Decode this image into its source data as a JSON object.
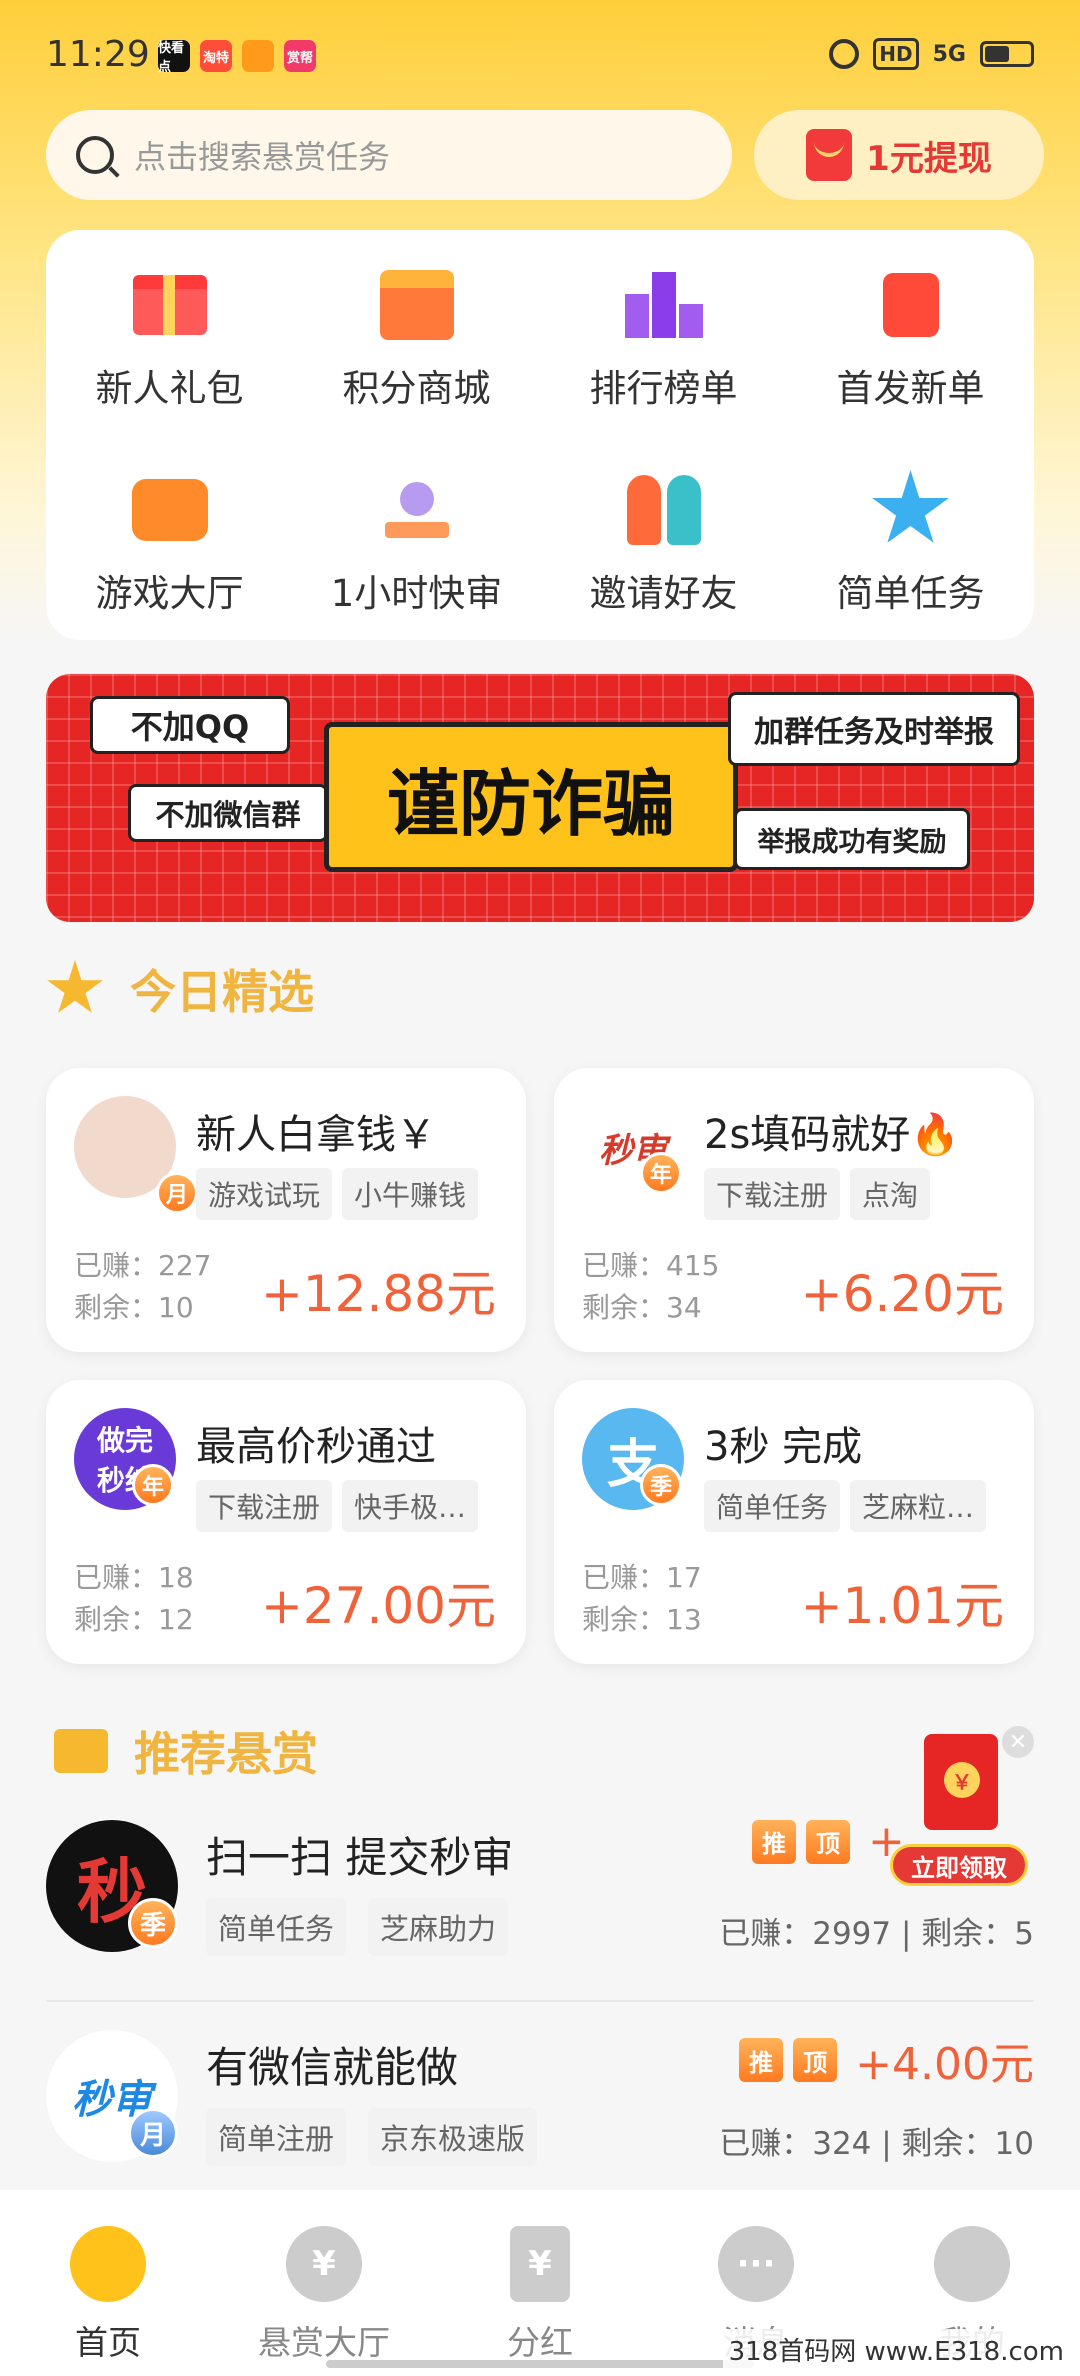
{
  "status": {
    "time": "11:29",
    "apps": [
      "快看点",
      "淘特",
      "",
      "赏帮"
    ],
    "hd": "HD",
    "network": "5G"
  },
  "search": {
    "placeholder": "点击搜索悬赏任务"
  },
  "withdraw": {
    "label": "1元提现"
  },
  "grid": [
    {
      "label": "新人礼包",
      "icon": "gift-icon"
    },
    {
      "label": "积分商城",
      "icon": "shop-icon"
    },
    {
      "label": "排行榜单",
      "icon": "podium-icon"
    },
    {
      "label": "首发新单",
      "icon": "red-packet-icon"
    },
    {
      "label": "游戏大厅",
      "icon": "gamepad-icon"
    },
    {
      "label": "1小时快审",
      "icon": "stamp-icon"
    },
    {
      "label": "邀请好友",
      "icon": "friends-icon"
    },
    {
      "label": "简单任务",
      "icon": "star-face-icon"
    }
  ],
  "banner": {
    "main": "谨防诈骗",
    "b1": "不加QQ",
    "b2": "不加微信群",
    "b3": "加群任务及时举报",
    "b4": "举报成功有奖励"
  },
  "today": {
    "title": "今日精选",
    "cards": [
      {
        "title": "新人白拿钱￥",
        "badge": "月",
        "avatar_text": "",
        "tags": [
          "游戏试玩",
          "小牛赚钱"
        ],
        "earned": "已赚：227",
        "left": "剩余：10",
        "price": "+12.88元"
      },
      {
        "title": "2s填码就好🔥",
        "badge": "年",
        "avatar_text": "秒审",
        "tags": [
          "下载注册",
          "点淘"
        ],
        "earned": "已赚：415",
        "left": "剩余：34",
        "price": "+6.20元"
      },
      {
        "title": "最高价秒通过",
        "badge": "年",
        "avatar_text": "做完秒结",
        "tags": [
          "下载注册",
          "快手极…"
        ],
        "earned": "已赚：18",
        "left": "剩余：12",
        "price": "+27.00元"
      },
      {
        "title": "3秒  完成",
        "badge": "季",
        "avatar_text": "支",
        "tags": [
          "简单任务",
          "芝麻粒…"
        ],
        "earned": "已赚：17",
        "left": "剩余：13",
        "price": "+1.01元"
      }
    ]
  },
  "recommend": {
    "title": "推荐悬赏",
    "rows": [
      {
        "title": "扫一扫 提交秒审",
        "avatar_text": "秒",
        "badge": "季",
        "tags": [
          "简单任务",
          "芝麻助力"
        ],
        "pill1": "推",
        "pill2": "顶",
        "price": "+",
        "stat": "已赚：2997 | 剩余：5"
      },
      {
        "title": "有微信就能做",
        "avatar_text": "秒审",
        "badge": "月",
        "tags": [
          "简单注册",
          "京东极速版"
        ],
        "pill1": "推",
        "pill2": "顶",
        "price": "+4.00元",
        "stat": "已赚：324 | 剩余：10"
      }
    ]
  },
  "float_packet": {
    "button": "立即领取",
    "coin": "￥"
  },
  "nav": [
    {
      "label": "首页",
      "icon": "home-icon",
      "active": true
    },
    {
      "label": "悬赏大厅",
      "icon": "money-bag-icon",
      "active": false
    },
    {
      "label": "分红",
      "icon": "dividend-icon",
      "active": false
    },
    {
      "label": "消息",
      "icon": "message-icon",
      "active": false
    },
    {
      "label": "我的",
      "icon": "profile-icon",
      "active": false
    }
  ],
  "watermark": "318首码网 www.E318.com",
  "colors": {
    "accent": "#ffcf3a",
    "price": "#f0623a",
    "title_gold": "#f0b540"
  }
}
